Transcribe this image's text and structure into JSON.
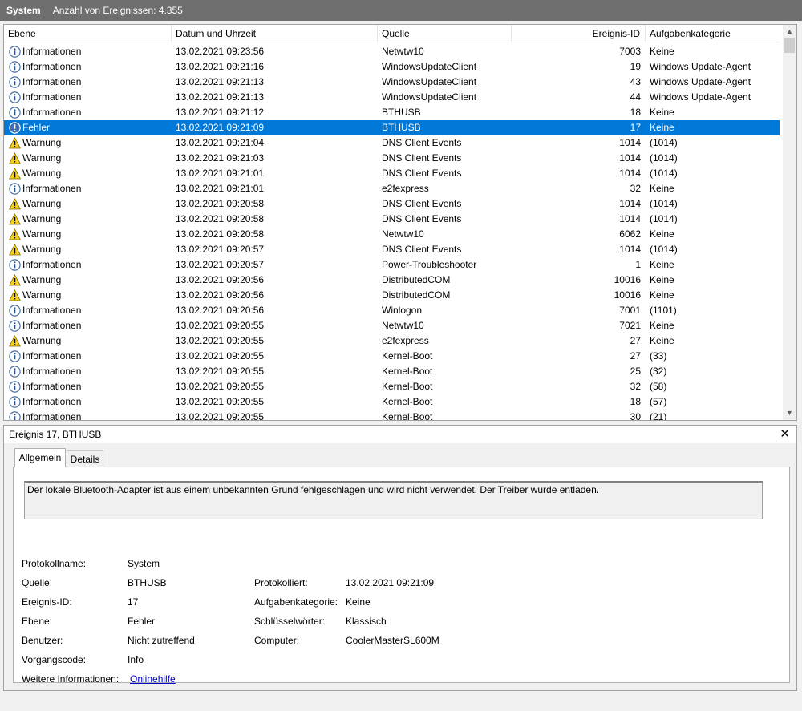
{
  "titlebar": {
    "log_name": "System",
    "count_text": "Anzahl von Ereignissen: 4.355"
  },
  "columns": {
    "level": "Ebene",
    "datetime": "Datum und Uhrzeit",
    "source": "Quelle",
    "event_id": "Ereignis-ID",
    "category": "Aufgabenkategorie"
  },
  "icons": {
    "info": "info-circle-icon",
    "warning": "warning-triangle-icon",
    "error": "error-circle-icon"
  },
  "colors": {
    "selection": "#0078d7",
    "link": "#0000cc"
  },
  "events": [
    {
      "type": "info",
      "level": "Informationen",
      "date": "13.02.2021 09:23:56",
      "source": "Netwtw10",
      "id": "7003",
      "category": "Keine"
    },
    {
      "type": "info",
      "level": "Informationen",
      "date": "13.02.2021 09:21:16",
      "source": "WindowsUpdateClient",
      "id": "19",
      "category": "Windows Update-Agent"
    },
    {
      "type": "info",
      "level": "Informationen",
      "date": "13.02.2021 09:21:13",
      "source": "WindowsUpdateClient",
      "id": "43",
      "category": "Windows Update-Agent"
    },
    {
      "type": "info",
      "level": "Informationen",
      "date": "13.02.2021 09:21:13",
      "source": "WindowsUpdateClient",
      "id": "44",
      "category": "Windows Update-Agent"
    },
    {
      "type": "info",
      "level": "Informationen",
      "date": "13.02.2021 09:21:12",
      "source": "BTHUSB",
      "id": "18",
      "category": "Keine"
    },
    {
      "type": "error",
      "level": "Fehler",
      "date": "13.02.2021 09:21:09",
      "source": "BTHUSB",
      "id": "17",
      "category": "Keine",
      "selected": true
    },
    {
      "type": "warning",
      "level": "Warnung",
      "date": "13.02.2021 09:21:04",
      "source": "DNS Client Events",
      "id": "1014",
      "category": "(1014)"
    },
    {
      "type": "warning",
      "level": "Warnung",
      "date": "13.02.2021 09:21:03",
      "source": "DNS Client Events",
      "id": "1014",
      "category": "(1014)"
    },
    {
      "type": "warning",
      "level": "Warnung",
      "date": "13.02.2021 09:21:01",
      "source": "DNS Client Events",
      "id": "1014",
      "category": "(1014)"
    },
    {
      "type": "info",
      "level": "Informationen",
      "date": "13.02.2021 09:21:01",
      "source": "e2fexpress",
      "id": "32",
      "category": "Keine"
    },
    {
      "type": "warning",
      "level": "Warnung",
      "date": "13.02.2021 09:20:58",
      "source": "DNS Client Events",
      "id": "1014",
      "category": "(1014)"
    },
    {
      "type": "warning",
      "level": "Warnung",
      "date": "13.02.2021 09:20:58",
      "source": "DNS Client Events",
      "id": "1014",
      "category": "(1014)"
    },
    {
      "type": "warning",
      "level": "Warnung",
      "date": "13.02.2021 09:20:58",
      "source": "Netwtw10",
      "id": "6062",
      "category": "Keine"
    },
    {
      "type": "warning",
      "level": "Warnung",
      "date": "13.02.2021 09:20:57",
      "source": "DNS Client Events",
      "id": "1014",
      "category": "(1014)"
    },
    {
      "type": "info",
      "level": "Informationen",
      "date": "13.02.2021 09:20:57",
      "source": "Power-Troubleshooter",
      "id": "1",
      "category": "Keine"
    },
    {
      "type": "warning",
      "level": "Warnung",
      "date": "13.02.2021 09:20:56",
      "source": "DistributedCOM",
      "id": "10016",
      "category": "Keine"
    },
    {
      "type": "warning",
      "level": "Warnung",
      "date": "13.02.2021 09:20:56",
      "source": "DistributedCOM",
      "id": "10016",
      "category": "Keine"
    },
    {
      "type": "info",
      "level": "Informationen",
      "date": "13.02.2021 09:20:56",
      "source": "Winlogon",
      "id": "7001",
      "category": "(1101)"
    },
    {
      "type": "info",
      "level": "Informationen",
      "date": "13.02.2021 09:20:55",
      "source": "Netwtw10",
      "id": "7021",
      "category": "Keine"
    },
    {
      "type": "warning",
      "level": "Warnung",
      "date": "13.02.2021 09:20:55",
      "source": "e2fexpress",
      "id": "27",
      "category": "Keine"
    },
    {
      "type": "info",
      "level": "Informationen",
      "date": "13.02.2021 09:20:55",
      "source": "Kernel-Boot",
      "id": "27",
      "category": "(33)"
    },
    {
      "type": "info",
      "level": "Informationen",
      "date": "13.02.2021 09:20:55",
      "source": "Kernel-Boot",
      "id": "25",
      "category": "(32)"
    },
    {
      "type": "info",
      "level": "Informationen",
      "date": "13.02.2021 09:20:55",
      "source": "Kernel-Boot",
      "id": "32",
      "category": "(58)"
    },
    {
      "type": "info",
      "level": "Informationen",
      "date": "13.02.2021 09:20:55",
      "source": "Kernel-Boot",
      "id": "18",
      "category": "(57)"
    },
    {
      "type": "info",
      "level": "Informationen",
      "date": "13.02.2021 09:20:55",
      "source": "Kernel-Boot",
      "id": "30",
      "category": "(21)"
    }
  ],
  "detail": {
    "title": "Ereignis 17, BTHUSB",
    "close_glyph": "✕",
    "tabs": {
      "general": "Allgemein",
      "details": "Details"
    },
    "description": "Der lokale Bluetooth-Adapter ist aus einem unbekannten Grund fehlgeschlagen und wird nicht verwendet. Der Treiber wurde entladen.",
    "labels": {
      "log_name": "Protokollname:",
      "source": "Quelle:",
      "event_id": "Ereignis-ID:",
      "level": "Ebene:",
      "user": "Benutzer:",
      "opcode": "Vorgangscode:",
      "more_info": "Weitere Informationen:",
      "logged": "Protokolliert:",
      "task_category": "Aufgabenkategorie:",
      "keywords": "Schlüsselwörter:",
      "computer": "Computer:"
    },
    "values": {
      "log_name": "System",
      "source": "BTHUSB",
      "event_id": "17",
      "level": "Fehler",
      "user": "Nicht zutreffend",
      "opcode": "Info",
      "more_info_link": "Onlinehilfe",
      "logged": "13.02.2021 09:21:09",
      "task_category": "Keine",
      "keywords": "Klassisch",
      "computer": "CoolerMasterSL600M"
    }
  }
}
